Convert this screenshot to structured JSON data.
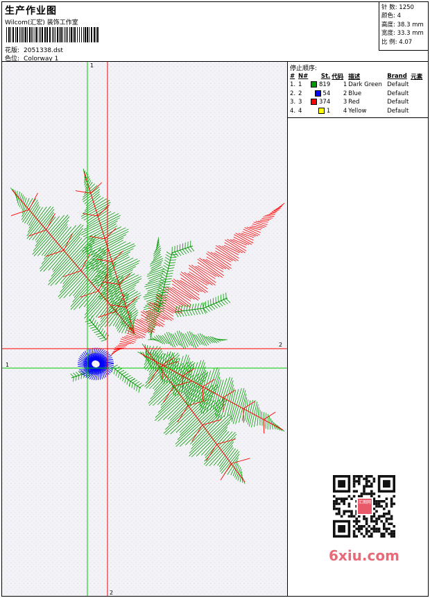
{
  "header": {
    "title": "生产作业图",
    "company": "Wilcom(汇宏) 装饰工作室",
    "design_label": "花版:",
    "design_value": "2051338.dst",
    "colorway_label": "色位:",
    "colorway_value": "Colorway 1"
  },
  "specs": [
    {
      "label": "针 数:",
      "value": "1250"
    },
    {
      "label": "颜色:",
      "value": "4"
    },
    {
      "label": "高度:",
      "value": "38.3 mm"
    },
    {
      "label": "宽度:",
      "value": "33.3 mm"
    },
    {
      "label": "比 例:",
      "value": "4.07"
    }
  ],
  "stop_sequence": {
    "title": "停止顺序:",
    "headers": [
      "#",
      "N#",
      "St.",
      "代码",
      "描述",
      "Brand",
      "元素"
    ],
    "rows": [
      {
        "idx": "1.",
        "n": "1",
        "color": "#009900",
        "st": "819",
        "code": "1",
        "desc": "Dark Green",
        "brand": "Default"
      },
      {
        "idx": "2.",
        "n": "2",
        "color": "#0000ff",
        "st": "54",
        "code": "2",
        "desc": "Blue",
        "brand": "Default"
      },
      {
        "idx": "3.",
        "n": "3",
        "color": "#ff0000",
        "st": "374",
        "code": "3",
        "desc": "Red",
        "brand": "Default"
      },
      {
        "idx": "4.",
        "n": "4",
        "color": "#ffff00",
        "st": "1",
        "code": "4",
        "desc": "Yellow",
        "brand": "Default"
      }
    ]
  },
  "axes": {
    "vertical_top_label": "1",
    "horizontal_right_label": "2",
    "horizontal_left_label": "1",
    "vertical_bottom_label": "2",
    "green_color": "#00cc00",
    "red_color": "#ff0000"
  },
  "watermark": {
    "seal_text": "汇图网",
    "brand": "6xiu.com"
  },
  "icons": [
    "barcode-icon",
    "qr-code-icon"
  ]
}
